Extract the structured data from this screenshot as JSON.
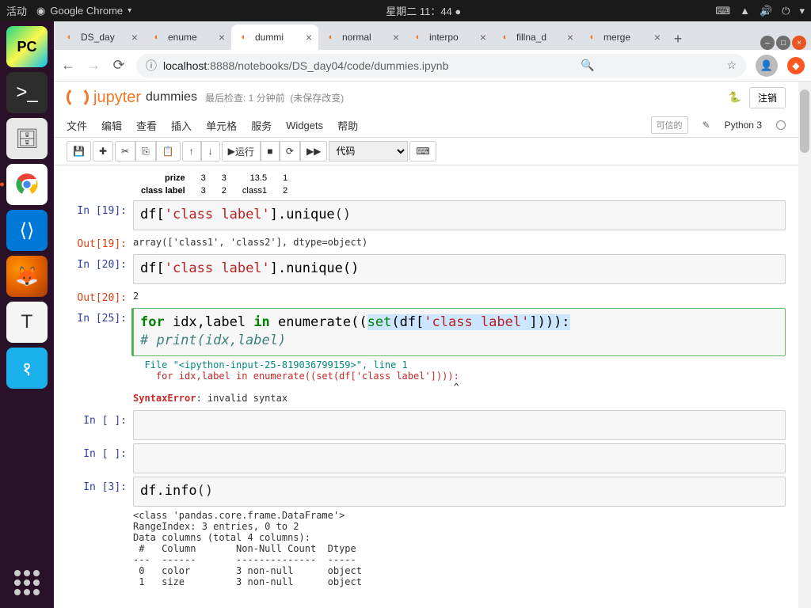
{
  "gnome": {
    "activities": "活动",
    "app_title": "Google Chrome",
    "clock": "星期二 11：44",
    "dot": "●"
  },
  "tabs": [
    {
      "title": "DS_day",
      "active": false
    },
    {
      "title": "enume",
      "active": false
    },
    {
      "title": "dummi",
      "active": true
    },
    {
      "title": "normal",
      "active": false
    },
    {
      "title": "interpo",
      "active": false
    },
    {
      "title": "fillna_d",
      "active": false
    },
    {
      "title": "merge",
      "active": false
    }
  ],
  "url": {
    "host": "localhost",
    "port": ":8888",
    "path": "/notebooks/DS_day04/code/dummies.ipynb"
  },
  "jupyter": {
    "logo_text": "jupyter",
    "notebook_name": "dummies",
    "checkpoint": "最后检查: 1 分钟前",
    "unsaved": "(未保存改变)",
    "logout": "注销",
    "menus": [
      "文件",
      "编辑",
      "查看",
      "插入",
      "单元格",
      "服务",
      "Widgets",
      "帮助"
    ],
    "trusted": "可信的",
    "kernel": "Python 3",
    "run_label": "运行",
    "cell_type": "代码"
  },
  "table": {
    "rows": [
      {
        "label": "prize",
        "c1": "3",
        "c2": "3",
        "c3": "13.5",
        "c4": "1"
      },
      {
        "label": "class label",
        "c1": "3",
        "c2": "2",
        "c3": "class1",
        "c4": "2"
      }
    ]
  },
  "cells": {
    "c19_in_prompt": "In [19]:",
    "c19_code_pre": "df[",
    "c19_code_str": "'class label'",
    "c19_code_mid": "].unique",
    "c19_code_paren": "()",
    "c19_out_prompt": "Out[19]:",
    "c19_out": "array(['class1', 'class2'], dtype=object)",
    "c20_in_prompt": "In [20]:",
    "c20_code_pre": "df[",
    "c20_code_str": "'class label'",
    "c20_code_mid": "].nunique()",
    "c20_out_prompt": "Out[20]:",
    "c20_out": "2",
    "c25_in_prompt": "In [25]:",
    "c25_kw_for": "for",
    "c25_txt1": " idx,label ",
    "c25_kw_in": "in",
    "c25_txt2": " enumerate((",
    "c25_builtin": "set",
    "c25_txt3": "(df[",
    "c25_str": "'class label'",
    "c25_txt4": "]))):",
    "c25_comment": "#     print(idx,label)",
    "c25_err_file": "  File \"<ipython-input-25-819036799159>\", line 1",
    "c25_err_code": "    for idx,label in enumerate((set(df['class label']))):",
    "c25_err_caret": "                                                        ^",
    "c25_err_name": "SyntaxError",
    "c25_err_msg": ": invalid syntax",
    "empty_prompt": "In [ ]:",
    "c3_in_prompt": "In [3]:",
    "c3_code_pre": "df.info",
    "c3_code_paren": "()",
    "c3_out": "<class 'pandas.core.frame.DataFrame'>\nRangeIndex: 3 entries, 0 to 2\nData columns (total 4 columns):\n #   Column       Non-Null Count  Dtype\n---  ------       --------------  -----\n 0   color        3 non-null      object\n 1   size         3 non-null      object"
  }
}
